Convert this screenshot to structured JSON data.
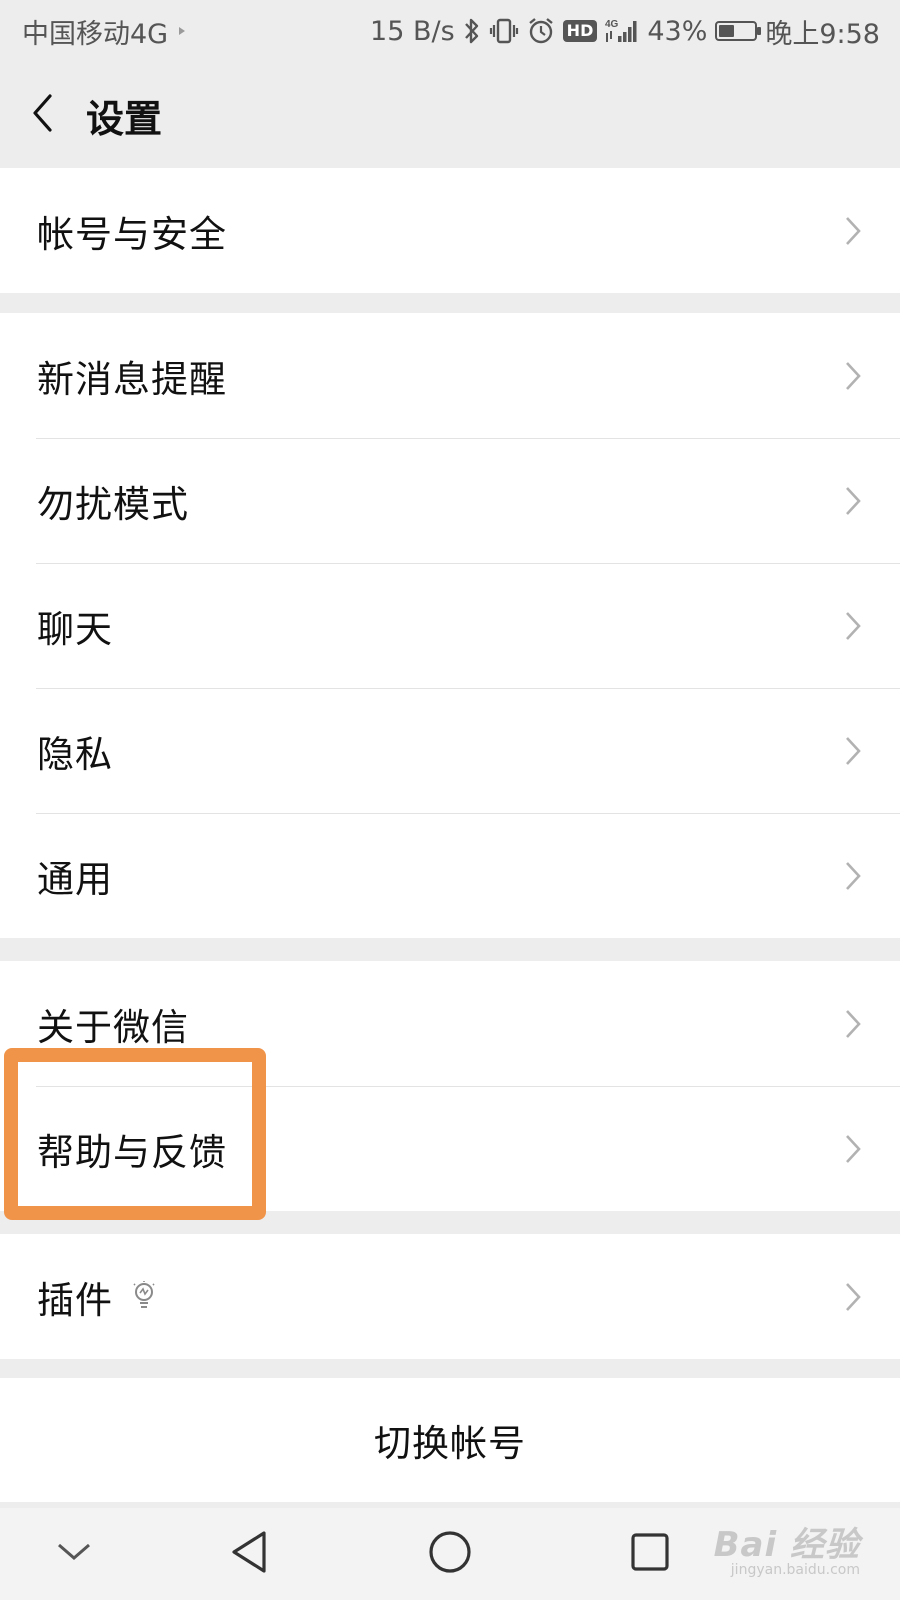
{
  "status_bar": {
    "carrier": "中国移动4G",
    "speed": "15 B/s",
    "hd": "HD",
    "signal_label": "4G",
    "battery": "43%",
    "battery_level": 0.43,
    "time": "晚上9:58"
  },
  "header": {
    "title": "设置"
  },
  "groups": [
    {
      "items": [
        {
          "label": "帐号与安全"
        }
      ]
    },
    {
      "items": [
        {
          "label": "新消息提醒"
        },
        {
          "label": "勿扰模式"
        },
        {
          "label": "聊天"
        },
        {
          "label": "隐私"
        },
        {
          "label": "通用"
        }
      ]
    },
    {
      "items": [
        {
          "label": "关于微信"
        },
        {
          "label": "帮助与反馈"
        }
      ]
    },
    {
      "items": [
        {
          "label": "插件",
          "icon": "lightbulb-icon"
        }
      ]
    }
  ],
  "switch_account": "切换帐号",
  "icons": {
    "back": "back-arrow-icon",
    "chevron": "chevron-right-icon",
    "nav_collapse": "chevron-down-icon",
    "nav_back": "triangle-back-icon",
    "nav_home": "circle-home-icon",
    "nav_recent": "square-recent-icon"
  },
  "colors": {
    "highlight": "#f0944a",
    "background": "#ededed"
  },
  "watermark": {
    "logo": "Bai 经验",
    "url": "jingyan.baidu.com"
  }
}
